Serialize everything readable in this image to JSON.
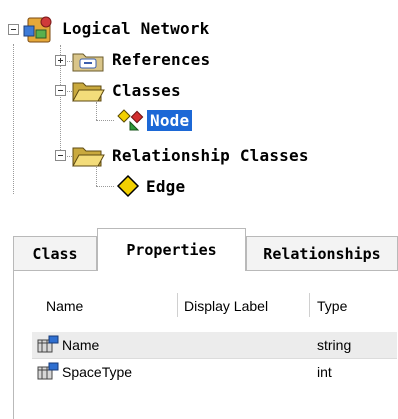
{
  "tree": {
    "root": {
      "label": "Logical Network",
      "expanded": true
    },
    "items": [
      {
        "label": "References",
        "expanded": false
      },
      {
        "label": "Classes",
        "expanded": true
      },
      {
        "label": "Node",
        "selected": true
      },
      {
        "label": "Relationship Classes",
        "expanded": true
      },
      {
        "label": "Edge"
      }
    ]
  },
  "tabs": [
    {
      "label": "Class"
    },
    {
      "label": "Properties",
      "active": true
    },
    {
      "label": "Relationships"
    }
  ],
  "properties_grid": {
    "columns": [
      "Name",
      "Display Label",
      "Type"
    ],
    "rows": [
      {
        "name": "Name",
        "display_label": "",
        "type": "string"
      },
      {
        "name": "SpaceType",
        "display_label": "",
        "type": "int"
      }
    ]
  },
  "colors": {
    "selection": "#1c68d6",
    "folder": "#e8c95a",
    "diamond": "#f2d000"
  }
}
